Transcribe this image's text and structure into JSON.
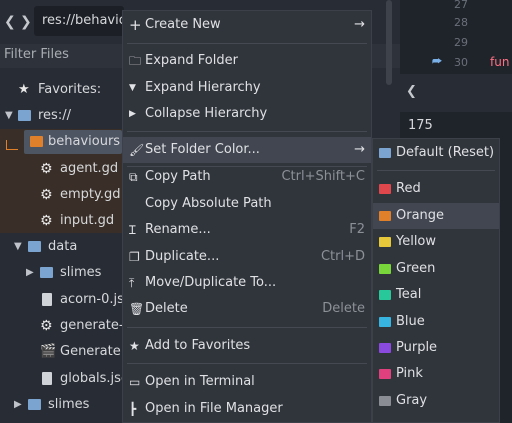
{
  "filesystem": {
    "path": "res://behavio",
    "filter_placeholder": "Filter Files",
    "favorites_label": "Favorites:",
    "root_label": "res://",
    "tree": [
      {
        "label": "behaviours",
        "selected": true
      },
      {
        "label": "agent.gd"
      },
      {
        "label": "empty.gd"
      },
      {
        "label": "input.gd"
      },
      {
        "label": "data"
      },
      {
        "label": "slimes"
      },
      {
        "label": "acorn-0.js"
      },
      {
        "label": "generate-"
      },
      {
        "label": "Generate."
      },
      {
        "label": "globals.jso"
      },
      {
        "label": "slimes"
      }
    ]
  },
  "editor": {
    "line_numbers": [
      "27",
      "28",
      "29",
      "30"
    ],
    "code_fragment": "fun",
    "field_value": "175"
  },
  "context_menu": {
    "items": [
      {
        "label": "Create New",
        "icon": "plus-icon",
        "arrow": "→"
      },
      {
        "label": "Expand Folder",
        "icon": "folder-open-icon"
      },
      {
        "label": "Expand Hierarchy",
        "icon": "chevron-down-icon"
      },
      {
        "label": "Collapse Hierarchy",
        "icon": "chevron-right-icon"
      },
      {
        "label": "Set Folder Color...",
        "icon": "brush-icon",
        "arrow": "→"
      },
      {
        "label": "Copy Path",
        "icon": "copy-icon",
        "shortcut": "Ctrl+Shift+C"
      },
      {
        "label": "Copy Absolute Path"
      },
      {
        "label": "Rename...",
        "icon": "rename-icon",
        "shortcut": "F2"
      },
      {
        "label": "Duplicate...",
        "icon": "duplicate-icon",
        "shortcut": "Ctrl+D"
      },
      {
        "label": "Move/Duplicate To...",
        "icon": "move-icon"
      },
      {
        "label": "Delete",
        "icon": "trash-icon",
        "shortcut": "Delete"
      },
      {
        "label": "Add to Favorites",
        "icon": "star-icon"
      },
      {
        "label": "Open in Terminal",
        "icon": "terminal-icon"
      },
      {
        "label": "Open in File Manager",
        "icon": "file-manager-icon"
      }
    ]
  },
  "color_submenu": {
    "items": [
      {
        "label": "Default (Reset)",
        "color": "#7ca4d0"
      },
      {
        "label": "Red",
        "color": "#e0474c"
      },
      {
        "label": "Orange",
        "color": "#e0802a"
      },
      {
        "label": "Yellow",
        "color": "#e6c83a"
      },
      {
        "label": "Green",
        "color": "#79d63a"
      },
      {
        "label": "Teal",
        "color": "#28c89a"
      },
      {
        "label": "Blue",
        "color": "#38b4e0"
      },
      {
        "label": "Purple",
        "color": "#8a4ae0"
      },
      {
        "label": "Pink",
        "color": "#e0407e"
      },
      {
        "label": "Gray",
        "color": "#8a8e94"
      }
    ]
  }
}
